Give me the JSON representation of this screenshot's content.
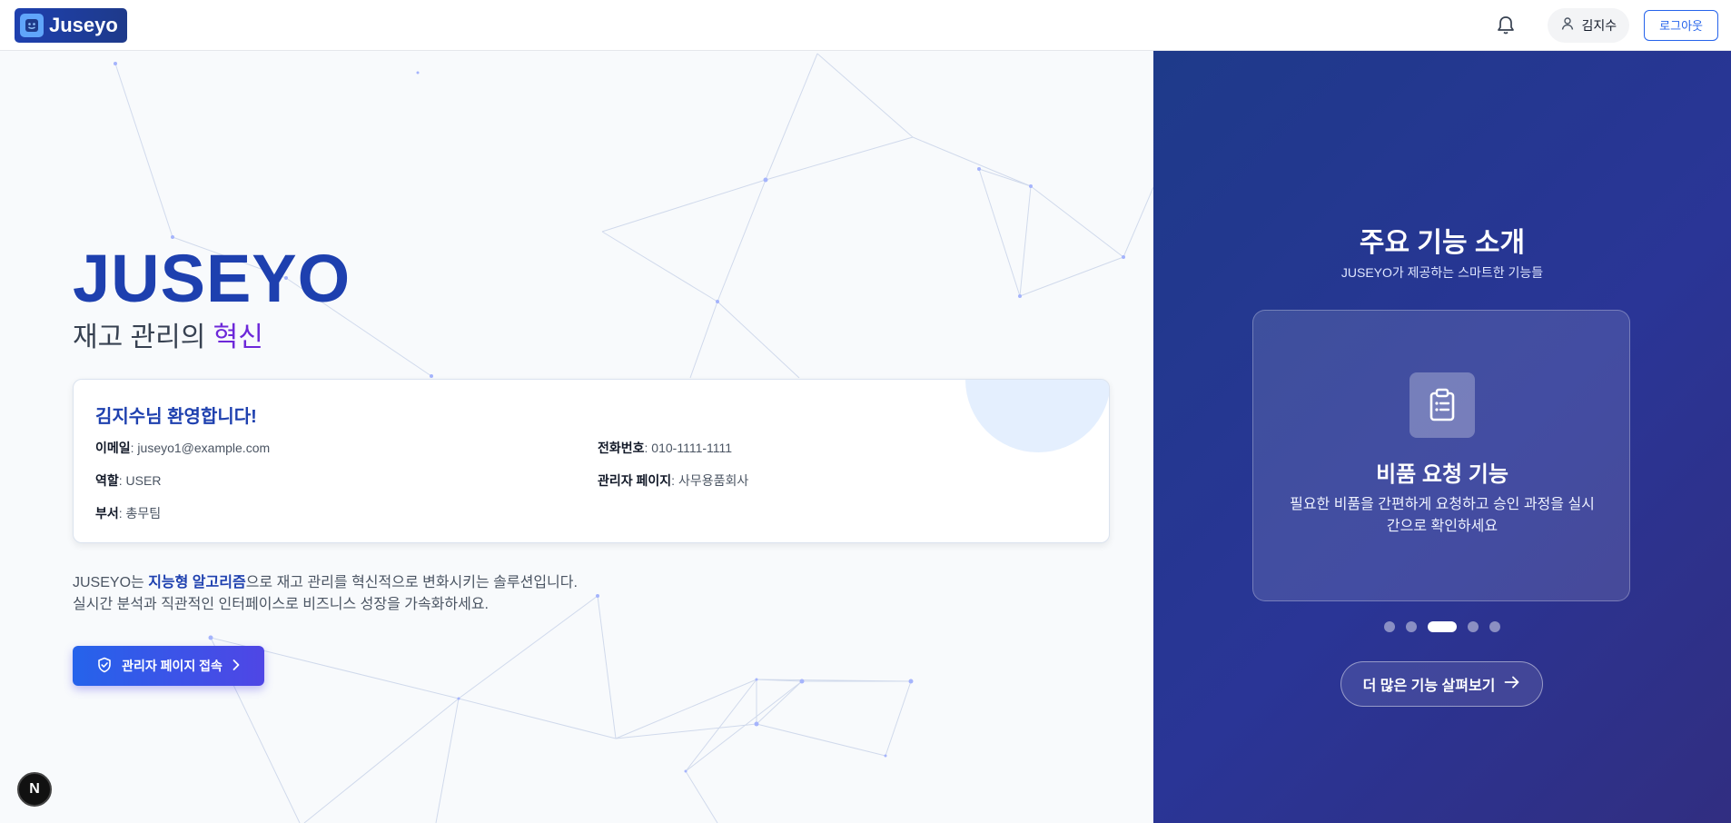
{
  "header": {
    "logo_text": "Juseyo",
    "user_name": "김지수",
    "logout_label": "로그아웃"
  },
  "hero": {
    "title": "JUSEYO",
    "subtitle_prefix": "재고 관리의 ",
    "subtitle_accent": "혁신"
  },
  "welcome_card": {
    "title": "김지수님 환영합니다!",
    "email_label": "이메일",
    "email_value": ": juseyo1@example.com",
    "phone_label": "전화번호",
    "phone_value": ": 010-1111-1111",
    "role_label": "역할",
    "role_value": ": USER",
    "admin_page_label": "관리자 페이지",
    "admin_page_value": ": 사무용품회사",
    "department_label": "부서",
    "department_value": ": 총무팀"
  },
  "description": {
    "line1_prefix": "JUSEYO는 ",
    "line1_highlight": "지능형 알고리즘",
    "line1_suffix": "으로 재고 관리를 혁신적으로 변화시키는 솔루션입니다.",
    "line2": "실시간 분석과 직관적인 인터페이스로 비즈니스 성장을 가속화하세요."
  },
  "admin_button_label": "관리자 페이지 접속",
  "badge_letter": "N",
  "features_panel": {
    "title": "주요 기능 소개",
    "subtitle": "JUSEYO가 제공하는 스마트한 기능들",
    "card_title": "비품 요청 기능",
    "card_desc": "필요한 비품을 간편하게 요청하고 승인 과정을 실시간으로 확인하세요",
    "more_button_label": "더 많은 기능 살펴보기",
    "carousel_count": 5,
    "carousel_active_index": 2
  },
  "icons": {
    "logo": "smile-face-icon",
    "bell": "bell-icon",
    "user": "user-icon",
    "admin": "shield-check-icon",
    "chevron": "chevron-right-icon",
    "feature": "clipboard-list-icon",
    "arrow": "arrow-right-icon"
  },
  "colors": {
    "brand": "#1e40af",
    "accent": "#6d28d9",
    "panel": "#2a3596"
  }
}
